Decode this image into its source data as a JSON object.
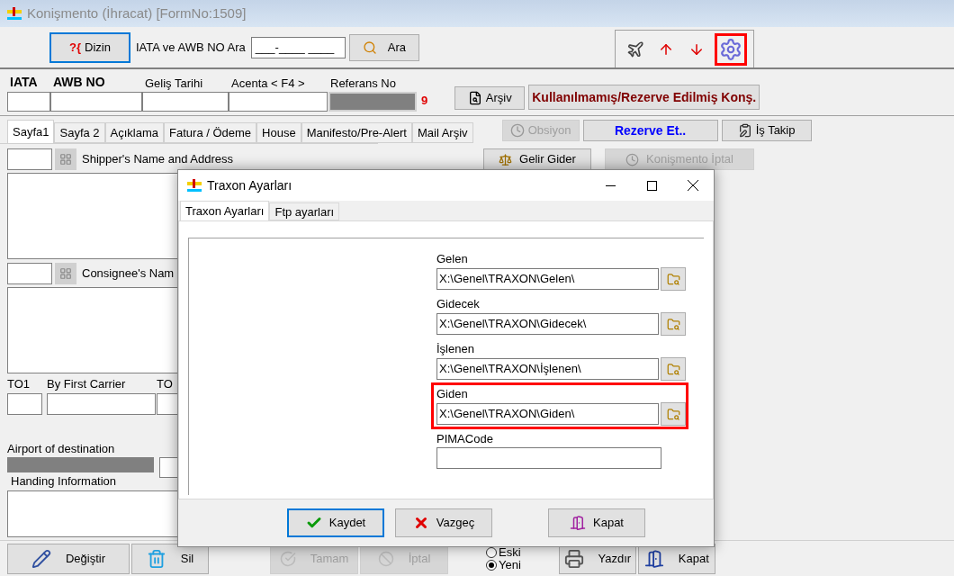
{
  "window": {
    "title": "Konişmento (İhracat) [FormNo:1509]"
  },
  "toolbar": {
    "index_button": {
      "icon": "?{",
      "label": "Dizin",
      "focused": true
    },
    "search_label": "IATA ve AWB NO Ara",
    "search_value": "___-____ ____",
    "search_button": "Ara",
    "tools": [
      {
        "kind": "plane",
        "highlighted": false
      },
      {
        "kind": "upload",
        "highlighted": false
      },
      {
        "kind": "download",
        "highlighted": false
      },
      {
        "kind": "settings",
        "highlighted": true
      }
    ]
  },
  "header": {
    "fields": [
      {
        "label": "IATA",
        "bold": true,
        "disabled": false
      },
      {
        "label": "AWB NO",
        "bold": true,
        "disabled": false
      },
      {
        "label": "Geliş Tarihi",
        "bold": false,
        "disabled": false
      },
      {
        "label": "Acenta  < F4 >",
        "bold": false,
        "disabled": false
      },
      {
        "label": "Referans No",
        "bold": false,
        "disabled": true
      }
    ],
    "reference_digit": "9",
    "archive_button": "Arşiv",
    "unused_button": "Kullanılmamış/Rezerve Edilmiş Konş."
  },
  "tabs": [
    {
      "label": "Sayfa1",
      "selected": true
    },
    {
      "label": "Sayfa 2",
      "selected": false
    },
    {
      "label": "Açıklama",
      "selected": false
    },
    {
      "label": "Fatura / Ödeme",
      "selected": false
    },
    {
      "label": "House",
      "selected": false
    },
    {
      "label": "Manifesto/Pre-Alert",
      "selected": false
    },
    {
      "label": "Mail Arşiv",
      "selected": false
    }
  ],
  "action_buttons": [
    {
      "label": "Obsiyon",
      "kind": "option",
      "disabled": true
    },
    {
      "label": "Rezerve Et..",
      "kind": "reserve",
      "disabled": false
    },
    {
      "label": "İş Takip",
      "kind": "tracking",
      "disabled": false
    }
  ],
  "form": {
    "shipper_label": "Shipper's Name and Address",
    "income_button": {
      "label": "Gelir Gider",
      "disabled": false
    },
    "cancel_button": {
      "label": "Konişmento İptal",
      "disabled": true
    },
    "consignee_label": "Consignee's Nam",
    "carrier_labels": [
      "TO1",
      "By First Carrier",
      "TO"
    ],
    "destination_label": "Airport of destination",
    "handling_label": "Handing Information"
  },
  "dialog": {
    "title": "Traxon Ayarları",
    "tabs": [
      {
        "label": "Traxon Ayarları",
        "selected": true
      },
      {
        "label": "Ftp ayarları",
        "selected": false
      }
    ],
    "fields": [
      {
        "label": "Gelen",
        "value": "X:\\Genel\\TRAXON\\Gelen\\",
        "browse": true,
        "highlighted": false
      },
      {
        "label": "Gidecek",
        "value": "X:\\Genel\\TRAXON\\Gidecek\\",
        "browse": true,
        "highlighted": false
      },
      {
        "label": "İşlenen",
        "value": "X:\\Genel\\TRAXON\\İşlenen\\",
        "browse": true,
        "highlighted": false
      },
      {
        "label": "Giden",
        "value": "X:\\Genel\\TRAXON\\Giden\\",
        "browse": true,
        "highlighted": true
      },
      {
        "label": "PIMACode",
        "browse": false,
        "highlighted": false
      }
    ],
    "buttons": [
      {
        "label": "Kaydet",
        "kind": "save",
        "focused": true
      },
      {
        "label": "Vazgeç",
        "kind": "cancel",
        "focused": false
      },
      {
        "label": "Kapat",
        "kind": "close",
        "focused": false
      }
    ]
  },
  "bottom_bar": {
    "buttons": [
      {
        "label": "Değiştir",
        "kind": "edit",
        "disabled": false
      },
      {
        "label": "Sil",
        "kind": "delete",
        "disabled": false
      },
      {
        "label": "Tamam",
        "kind": "ok",
        "disabled": true
      },
      {
        "label": "İptal",
        "kind": "abort",
        "disabled": true
      }
    ],
    "radios": [
      {
        "label": "Eski",
        "selected": false
      },
      {
        "label": "Yeni",
        "selected": true
      }
    ],
    "right_buttons": [
      {
        "label": "Yazdır",
        "kind": "print",
        "disabled": false
      },
      {
        "label": "Kapat",
        "kind": "exit",
        "disabled": false
      }
    ]
  }
}
